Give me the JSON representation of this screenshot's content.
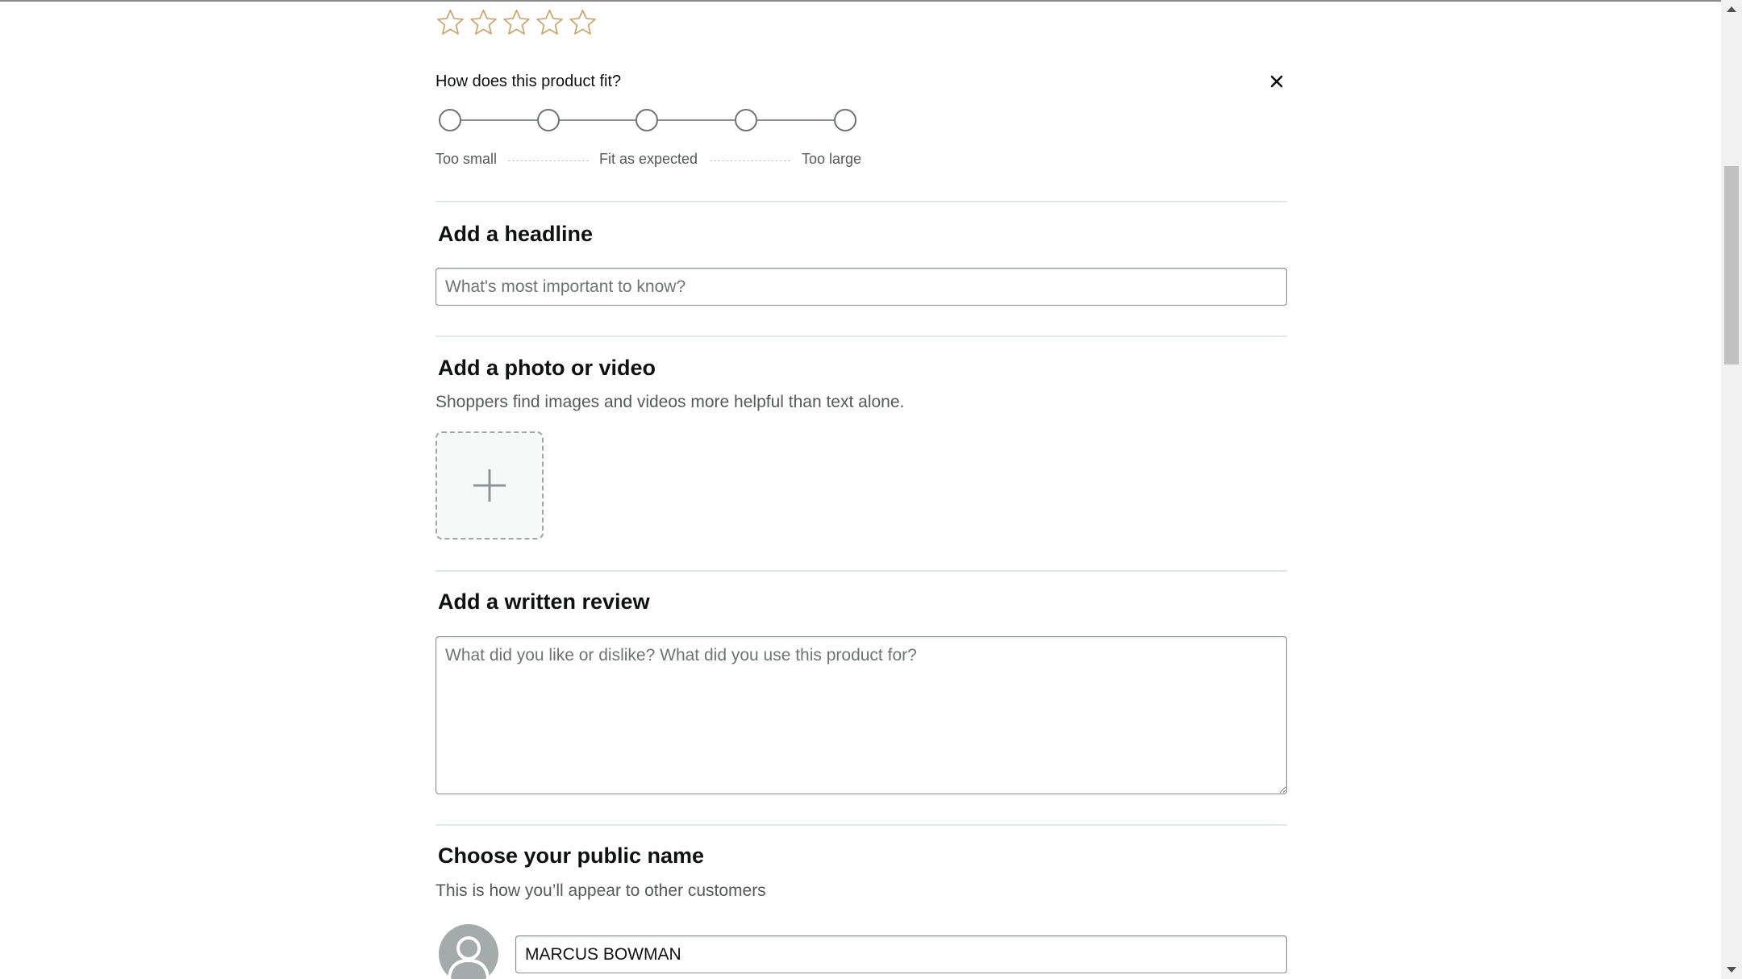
{
  "rating": {
    "star_count": 5,
    "selected": 0,
    "star_outline_color": "#c7a46d"
  },
  "fit": {
    "question": "How does this product fit?",
    "options_count": 5,
    "labels": {
      "too_small": "Too small",
      "as_expected": "Fit as expected",
      "too_large": "Too large"
    }
  },
  "headline": {
    "title": "Add a headline",
    "placeholder": "What's most important to know?"
  },
  "media": {
    "title": "Add a photo or video",
    "subtitle": "Shoppers find images and videos more helpful than text alone."
  },
  "review": {
    "title": "Add a written review",
    "placeholder": "What did you like or dislike? What did you use this product for?"
  },
  "public_name": {
    "title": "Choose your public name",
    "subtitle": "This is how you’ll appear to other customers",
    "value": "MARCUS BOWMAN"
  }
}
